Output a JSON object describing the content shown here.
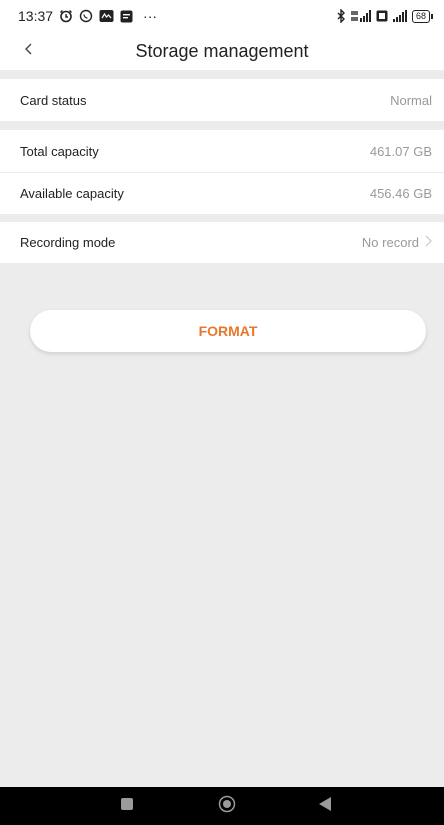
{
  "status_bar": {
    "time": "13:37",
    "more_indicator": "···",
    "battery_level": "68",
    "icons_left": [
      "alarm-icon",
      "whatsapp-icon",
      "app-icon",
      "message-icon"
    ],
    "icons_right": [
      "bluetooth-icon",
      "signal-4g-icon",
      "sim-icon",
      "signal-icon",
      "battery-icon"
    ]
  },
  "header": {
    "title": "Storage management",
    "back_icon": "chevron-left-icon"
  },
  "rows": {
    "card_status": {
      "label": "Card status",
      "value": "Normal"
    },
    "total_capacity": {
      "label": "Total capacity",
      "value": "461.07 GB"
    },
    "available_capacity": {
      "label": "Available capacity",
      "value": "456.46 GB"
    },
    "recording_mode": {
      "label": "Recording mode",
      "value": "No record",
      "icon": "chevron-right-icon"
    }
  },
  "format_button": {
    "label": "FORMAT"
  },
  "nav_bar": {
    "items": [
      "recents-square-icon",
      "home-circle-icon",
      "back-triangle-icon"
    ]
  },
  "colors": {
    "accent": "#e8782b",
    "background": "#ececec",
    "secondary_text": "#999999"
  }
}
